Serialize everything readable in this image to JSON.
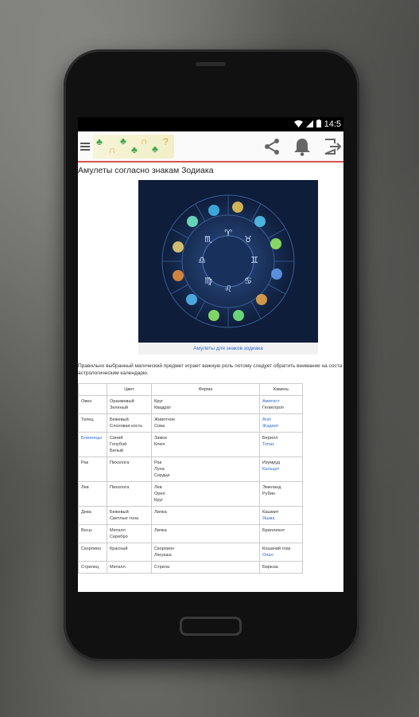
{
  "status": {
    "time": "14:5",
    "wifi_icon": "wifi-icon",
    "signal_icon": "signal-icon",
    "battery_icon": "battery-icon"
  },
  "toolbar": {
    "menu_icon": "menu-icon",
    "share_icon": "share-icon",
    "bell_icon": "bell-icon",
    "exit_icon": "exit-icon"
  },
  "article": {
    "title": "Амулеты согласно знакам Зодиака",
    "figure_caption": "Амулеты для знаков зодиака",
    "paragraph_line1": "Правильно выбранный магический предмет играет важную роль потому следует обратить внимание на соста",
    "paragraph_line2": "астрологическим календарю."
  },
  "table": {
    "headers": [
      "",
      "Цвет",
      "Форма",
      "Камень"
    ],
    "rows": [
      {
        "sign": "Овен",
        "color": [
          "Оранжевый",
          "Зеленый"
        ],
        "shape": [
          "Круг",
          "Квадрат"
        ],
        "stone": [
          {
            "t": "Аметист",
            "link": true
          },
          {
            "t": "Гелиотроп",
            "link": false
          }
        ]
      },
      {
        "sign": "Телец",
        "color": [
          "Бежевый",
          "Слоновая кость"
        ],
        "shape": [
          "Животное",
          "Сова"
        ],
        "stone": [
          {
            "t": "Агат",
            "link": true
          },
          {
            "t": "Жадеит",
            "link": true
          }
        ]
      },
      {
        "sign": "Близнецы",
        "sign_link": true,
        "color": [
          "Синий",
          "Голубой",
          "Белый"
        ],
        "shape": [
          "Замок",
          "Ключ"
        ],
        "stone": [
          {
            "t": "Берилл",
            "link": false
          },
          {
            "t": "Топаз",
            "link": true
          }
        ]
      },
      {
        "sign": "Рак",
        "color": [
          "Пихолога"
        ],
        "shape": [
          "Рак",
          "Луна",
          "Сердце"
        ],
        "stone": [
          {
            "t": "Изумруд",
            "link": false
          },
          {
            "t": "Кальцит",
            "link": true
          }
        ]
      },
      {
        "sign": "Лев",
        "color": [
          "Пихолога"
        ],
        "shape": [
          "Лев",
          "Орел",
          "Круг"
        ],
        "stone": [
          {
            "t": "Эмеланд",
            "link": false
          },
          {
            "t": "Рубин",
            "link": false
          }
        ]
      },
      {
        "sign": "Дева",
        "color": [
          "Бежевый",
          "Светлые тона"
        ],
        "shape": [
          "Лилка"
        ],
        "stone": [
          {
            "t": "Кашмит",
            "link": false
          },
          {
            "t": "Яшма",
            "link": true
          }
        ]
      },
      {
        "sign": "Весы",
        "color": [
          "Металл",
          "Серебро"
        ],
        "shape": [
          "Лилка"
        ],
        "stone": [
          {
            "t": "Бриллиант",
            "link": false
          }
        ]
      },
      {
        "sign": "Скорпион",
        "color": [
          "Красный"
        ],
        "shape": [
          "Скорпион",
          "Лягушка"
        ],
        "stone": [
          {
            "t": "Кошачий глаз",
            "link": false
          },
          {
            "t": "Опал",
            "link": true
          }
        ]
      },
      {
        "sign": "Стрелец",
        "color": [
          "Металл"
        ],
        "shape": [
          "Стрела"
        ],
        "stone": [
          {
            "t": "Бирюза",
            "link": false
          }
        ]
      }
    ]
  }
}
